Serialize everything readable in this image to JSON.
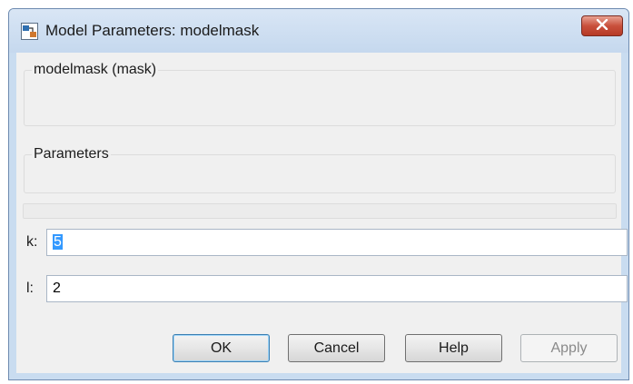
{
  "window": {
    "title": "Model Parameters: modelmask",
    "app_icon": "simulink-model-icon",
    "close_icon": "close-icon"
  },
  "groups": {
    "mask_title": "modelmask (mask)",
    "parameters_title": "Parameters"
  },
  "parameters": [
    {
      "label": "k:",
      "value": "5",
      "selected": true
    },
    {
      "label": "l:",
      "value": "2",
      "selected": false
    }
  ],
  "buttons": {
    "ok": "OK",
    "cancel": "Cancel",
    "help": "Help",
    "apply": "Apply"
  },
  "colors": {
    "titlebar": "#c9dcf0",
    "close_button": "#c9503c",
    "selection": "#3399ff"
  }
}
